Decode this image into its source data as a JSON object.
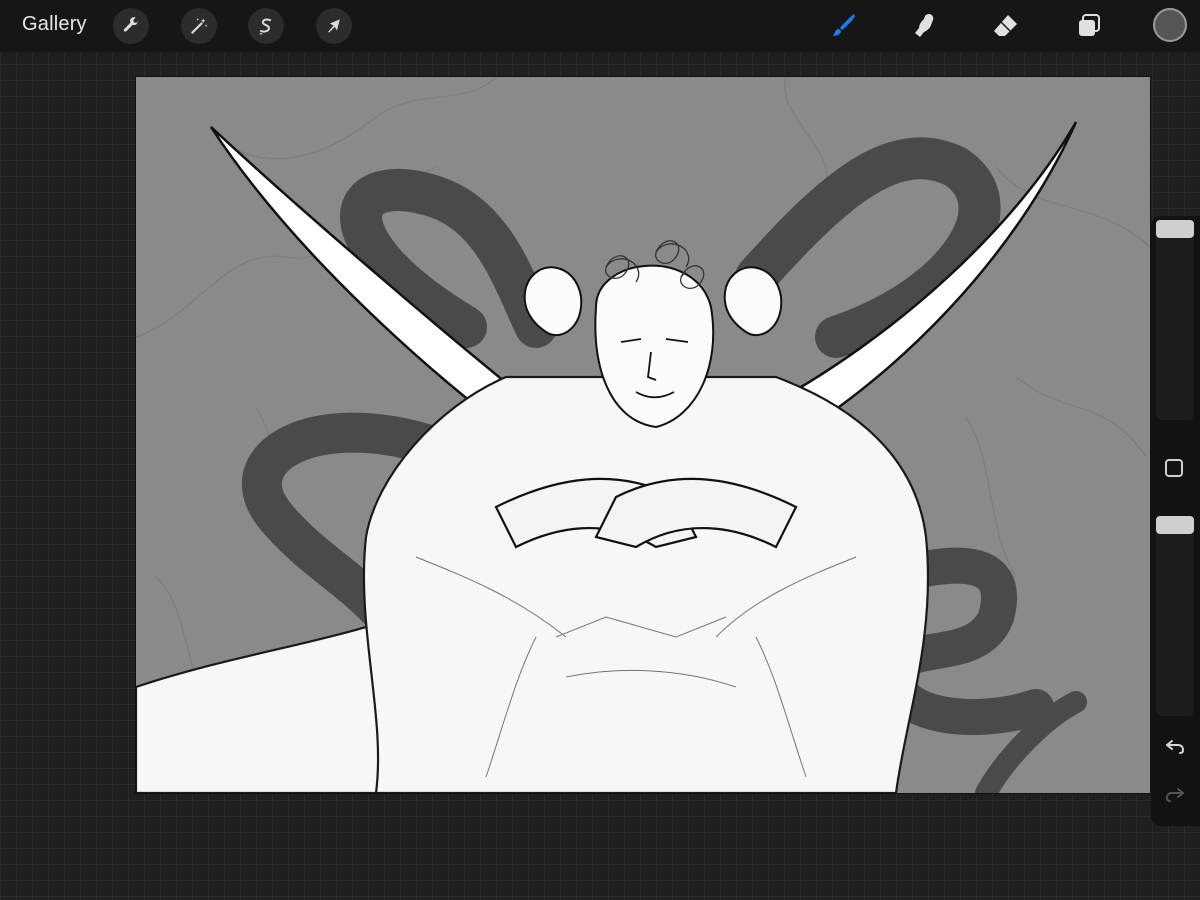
{
  "toolbar": {
    "gallery_label": "Gallery",
    "left_tools": [
      {
        "name": "actions",
        "icon": "wrench-icon"
      },
      {
        "name": "adjustments",
        "icon": "magic-wand-icon"
      },
      {
        "name": "selection",
        "icon": "selection-s-icon"
      },
      {
        "name": "transform",
        "icon": "arrow-cursor-icon"
      }
    ],
    "right_tools": [
      {
        "name": "brush",
        "icon": "brush-icon",
        "active": true
      },
      {
        "name": "smudge",
        "icon": "smudge-finger-icon"
      },
      {
        "name": "eraser",
        "icon": "eraser-icon"
      },
      {
        "name": "layers",
        "icon": "layers-icon"
      }
    ],
    "current_color": "#555555",
    "active_tool_color": "#1a7cf5"
  },
  "sidebar": {
    "brush_size_level": 0.0,
    "brush_opacity_level": 0.0,
    "modify_icon": "square-icon",
    "undo_icon": "undo-arrow-icon",
    "redo_icon": "redo-arrow-icon"
  },
  "canvas": {
    "background_color": "#8a8a8a",
    "subject": "sketch"
  }
}
